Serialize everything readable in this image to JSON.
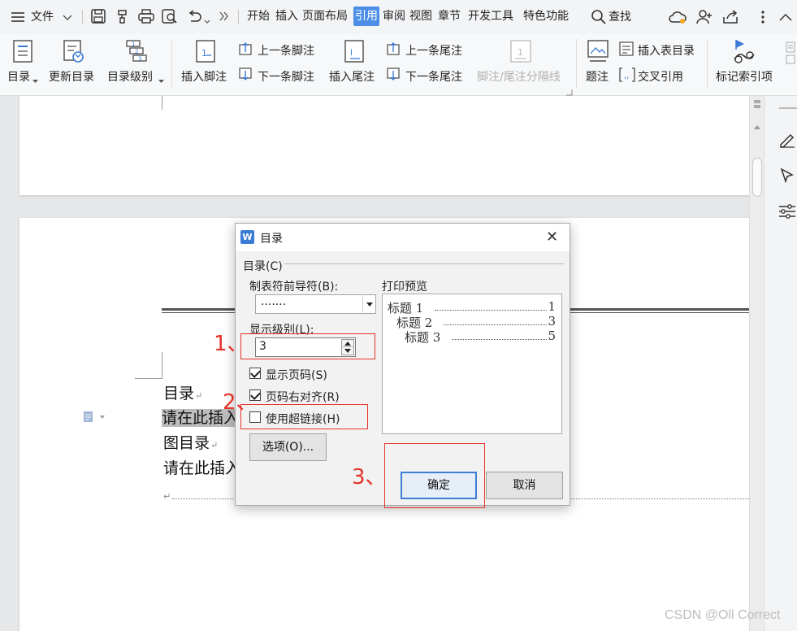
{
  "menubar": {
    "file_label": "文件",
    "tabs": [
      "开始",
      "插入",
      "页面布局",
      "引用",
      "审阅",
      "视图",
      "章节",
      "开发工具",
      "特色功能"
    ],
    "active_tab": "引用",
    "search_label": "查找"
  },
  "ribbon": {
    "toc_label": "目录",
    "update_toc_label": "更新目录",
    "toc_level_label": "目录级别",
    "insert_footnote_label": "插入脚注",
    "prev_footnote_label": "上一条脚注",
    "next_footnote_label": "下一条脚注",
    "insert_endnote_label": "插入尾注",
    "prev_endnote_label": "上一条尾注",
    "next_endnote_label": "下一条尾注",
    "separator_label": "脚注/尾注分隔线",
    "caption_label": "题注",
    "insert_table_of_figures_label": "插入表目录",
    "cross_ref_label": "交叉引用",
    "mark_index_label": "标记索引项"
  },
  "document": {
    "line1": "目录",
    "line2": "请在此插入",
    "line3": "图目录",
    "line4": "请在此插入"
  },
  "dialog": {
    "title": "目录",
    "group_label": "目录(C)",
    "tab_leader_label": "制表符前导符(B):",
    "tab_leader_value": ".......",
    "show_levels_label": "显示级别(L):",
    "show_levels_value": "3",
    "show_page_numbers_label": "显示页码(S)",
    "show_page_numbers_checked": true,
    "right_align_label": "页码右对齐(R)",
    "right_align_checked": true,
    "use_hyperlinks_label": "使用超链接(H)",
    "use_hyperlinks_checked": false,
    "options_button": "选项(O)...",
    "preview_label": "打印预览",
    "preview": [
      {
        "text": "标题 1",
        "page": "1"
      },
      {
        "text": "标题 2",
        "page": "3"
      },
      {
        "text": "标题 3",
        "page": "5"
      }
    ],
    "ok_button": "确定",
    "cancel_button": "取消"
  },
  "annotations": {
    "step1": "1、",
    "step2": "2、",
    "step3": "3、",
    "color": "#e5332a"
  },
  "watermark": "CSDN @Oll Correct",
  "colors": {
    "accent": "#4d8fe6",
    "annotation": "#e5332a"
  }
}
